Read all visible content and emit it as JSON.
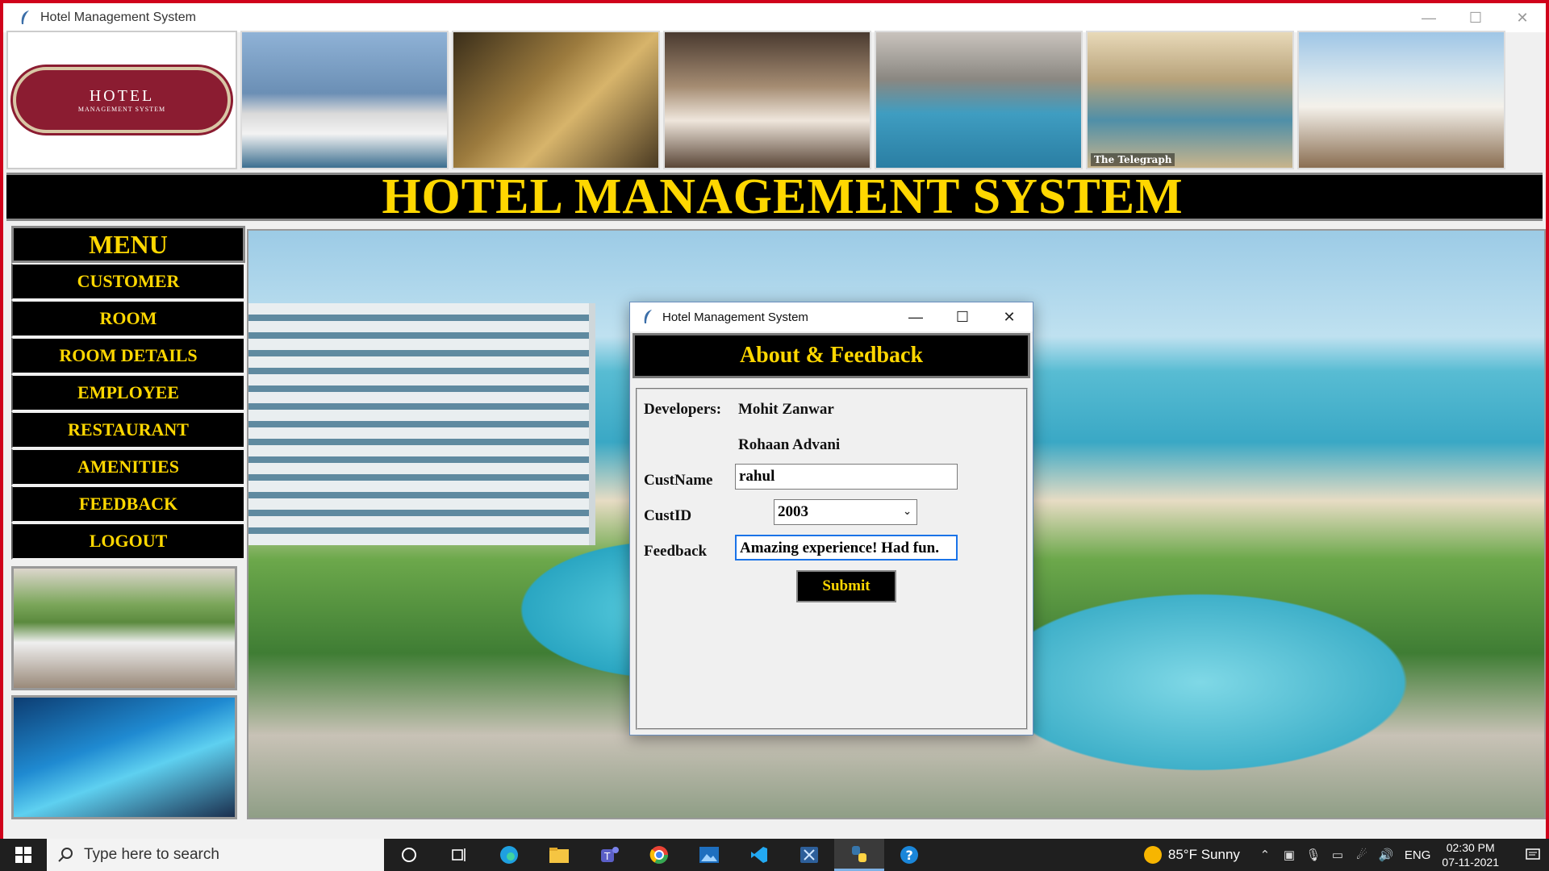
{
  "window": {
    "title": "Hotel Management System"
  },
  "banner": {
    "logo": {
      "main": "HOTEL",
      "sub": "MANAGEMENT SYSTEM"
    },
    "photo_caption": "The Telegraph"
  },
  "header": {
    "title": "HOTEL MANAGEMENT SYSTEM"
  },
  "menu": {
    "title": "MENU",
    "items": [
      "CUSTOMER",
      "ROOM",
      "ROOM DETAILS",
      "EMPLOYEE",
      "RESTAURANT",
      "AMENITIES",
      "FEEDBACK",
      "LOGOUT"
    ]
  },
  "dialog": {
    "title": "Hotel Management System",
    "heading": "About & Feedback",
    "developers_label": "Developers:",
    "developers": [
      "Mohit Zanwar",
      "Rohaan Advani"
    ],
    "custname_label": "CustName",
    "custname_value": "rahul",
    "custid_label": "CustID",
    "custid_value": "2003",
    "feedback_label": "Feedback",
    "feedback_value": "Amazing experience! Had fun.",
    "submit_label": "Submit"
  },
  "taskbar": {
    "search_placeholder": "Type here to search",
    "weather": "85°F  Sunny",
    "language": "ENG",
    "time": "02:30 PM",
    "date": "07-11-2021"
  },
  "colors": {
    "accent_gold": "#ffd700",
    "brand_maroon": "#8b1c31",
    "frame_red": "#d0021b"
  }
}
